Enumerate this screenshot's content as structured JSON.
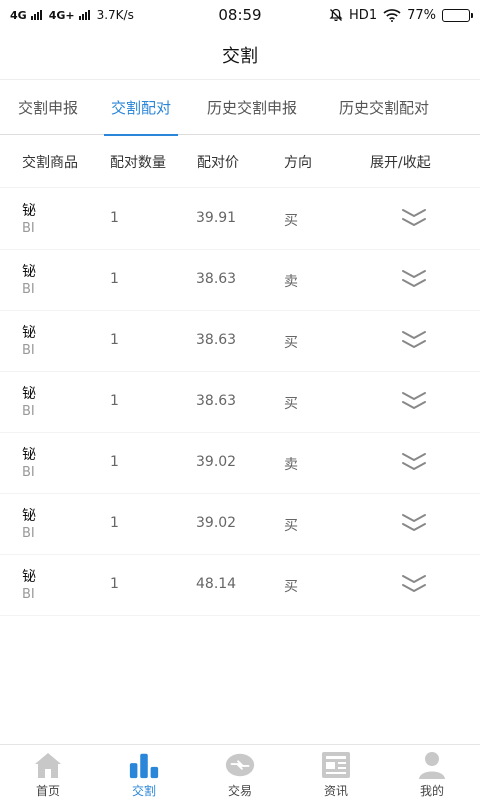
{
  "status_bar": {
    "network1": "4G",
    "network2": "4G+",
    "speed": "3.7K/s",
    "time": "08:59",
    "hd": "HD1",
    "battery_text": "77%",
    "battery_level": 0.77
  },
  "header": {
    "title": "交割"
  },
  "tabs": [
    {
      "label": "交割申报",
      "active": false
    },
    {
      "label": "交割配对",
      "active": true
    },
    {
      "label": "历史交割申报",
      "active": false
    },
    {
      "label": "历史交割配对",
      "active": false
    }
  ],
  "table": {
    "columns": [
      "交割商品",
      "配对数量",
      "配对价",
      "方向",
      "展开/收起"
    ],
    "rows": [
      {
        "name": "铋",
        "code": "BI",
        "qty": "1",
        "price": "39.91",
        "direction": "买"
      },
      {
        "name": "铋",
        "code": "BI",
        "qty": "1",
        "price": "38.63",
        "direction": "卖"
      },
      {
        "name": "铋",
        "code": "BI",
        "qty": "1",
        "price": "38.63",
        "direction": "买"
      },
      {
        "name": "铋",
        "code": "BI",
        "qty": "1",
        "price": "38.63",
        "direction": "买"
      },
      {
        "name": "铋",
        "code": "BI",
        "qty": "1",
        "price": "39.02",
        "direction": "卖"
      },
      {
        "name": "铋",
        "code": "BI",
        "qty": "1",
        "price": "39.02",
        "direction": "买"
      },
      {
        "name": "铋",
        "code": "BI",
        "qty": "1",
        "price": "48.14",
        "direction": "买"
      }
    ]
  },
  "bottom_nav": {
    "items": [
      {
        "label": "首页",
        "icon": "home-icon",
        "active": false
      },
      {
        "label": "交割",
        "icon": "bar-chart-icon",
        "active": true
      },
      {
        "label": "交易",
        "icon": "trade-icon",
        "active": false
      },
      {
        "label": "资讯",
        "icon": "news-icon",
        "active": false
      },
      {
        "label": "我的",
        "icon": "user-icon",
        "active": false
      }
    ]
  },
  "colors": {
    "accent": "#2a86d8",
    "inactive_icon": "#c8c8c8"
  }
}
